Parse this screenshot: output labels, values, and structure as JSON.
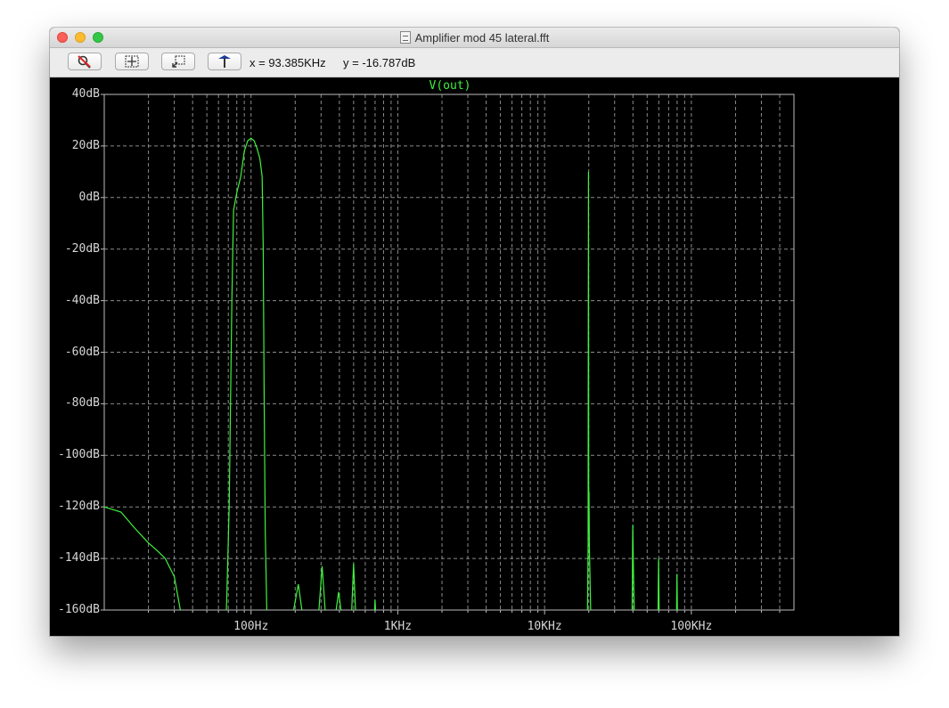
{
  "window": {
    "title": "Amplifier mod 45 lateral.fft"
  },
  "toolbar": {
    "buttons": [
      {
        "name": "zoom-cancel",
        "icon": "zoom-cancel-icon"
      },
      {
        "name": "zoom-extents",
        "icon": "zoom-extents-icon"
      },
      {
        "name": "zoom-back",
        "icon": "zoom-back-icon"
      },
      {
        "name": "probe",
        "icon": "probe-icon"
      }
    ],
    "cursor_x": "x = 93.385KHz",
    "cursor_y": "y = -16.787dB"
  },
  "plot": {
    "trace_name": "V(out)",
    "trace_color": "#3ef23e",
    "background": "#000000",
    "grid_color": "#8a8a8a",
    "y_tick_labels": [
      "40dB",
      "20dB",
      "0dB",
      "-20dB",
      "-40dB",
      "-60dB",
      "-80dB",
      "-100dB",
      "-120dB",
      "-140dB",
      "-160dB"
    ],
    "x_tick_labels": [
      "100Hz",
      "1KHz",
      "10KHz",
      "100KHz"
    ]
  },
  "chart_data": {
    "type": "line",
    "title": "V(out)",
    "xlabel": "",
    "ylabel": "",
    "x_scale": "log",
    "xlim": [
      10,
      500000
    ],
    "ylim": [
      -160,
      40
    ],
    "grid": true,
    "series": [
      {
        "name": "V(out)",
        "color": "#3ef23e",
        "segments": [
          [
            [
              10,
              -120
            ],
            [
              13,
              -122
            ],
            [
              16,
              -128
            ],
            [
              20,
              -134
            ],
            [
              23,
              -137
            ],
            [
              26,
              -140
            ],
            [
              30,
              -147
            ],
            [
              33,
              -160
            ]
          ],
          [
            [
              68,
              -160
            ],
            [
              71,
              -120
            ],
            [
              74,
              -40
            ],
            [
              76,
              -5
            ],
            [
              80,
              2
            ],
            [
              85,
              8
            ],
            [
              90,
              18
            ],
            [
              95,
              22
            ],
            [
              100,
              23
            ],
            [
              105,
              22
            ],
            [
              110,
              19
            ],
            [
              115,
              15
            ],
            [
              119,
              8
            ],
            [
              121,
              -20
            ],
            [
              123,
              -80
            ],
            [
              125,
              -130
            ],
            [
              128,
              -160
            ]
          ],
          [
            [
              195,
              -160
            ],
            [
              210,
              -150
            ],
            [
              222,
              -160
            ]
          ],
          [
            [
              290,
              -160
            ],
            [
              305,
              -143
            ],
            [
              320,
              -160
            ]
          ],
          [
            [
              380,
              -160
            ],
            [
              395,
              -153
            ],
            [
              410,
              -160
            ]
          ],
          [
            [
              485,
              -160
            ],
            [
              500,
              -142
            ],
            [
              515,
              -160
            ]
          ],
          [
            [
              695,
              -160
            ],
            [
              700,
              -156
            ],
            [
              705,
              -160
            ]
          ],
          [
            [
              19600,
              -160
            ],
            [
              19800,
              -135
            ],
            [
              19920,
              10
            ],
            [
              20000,
              -130
            ],
            [
              20080,
              -114
            ],
            [
              20200,
              -135
            ],
            [
              20600,
              -160
            ]
          ],
          [
            [
              39500,
              -160
            ],
            [
              39900,
              -127
            ],
            [
              40300,
              -145
            ],
            [
              40800,
              -160
            ]
          ],
          [
            [
              59300,
              -160
            ],
            [
              59800,
              -140
            ],
            [
              60300,
              -160
            ]
          ],
          [
            [
              79300,
              -160
            ],
            [
              79800,
              -146
            ],
            [
              80300,
              -160
            ]
          ]
        ]
      }
    ]
  }
}
